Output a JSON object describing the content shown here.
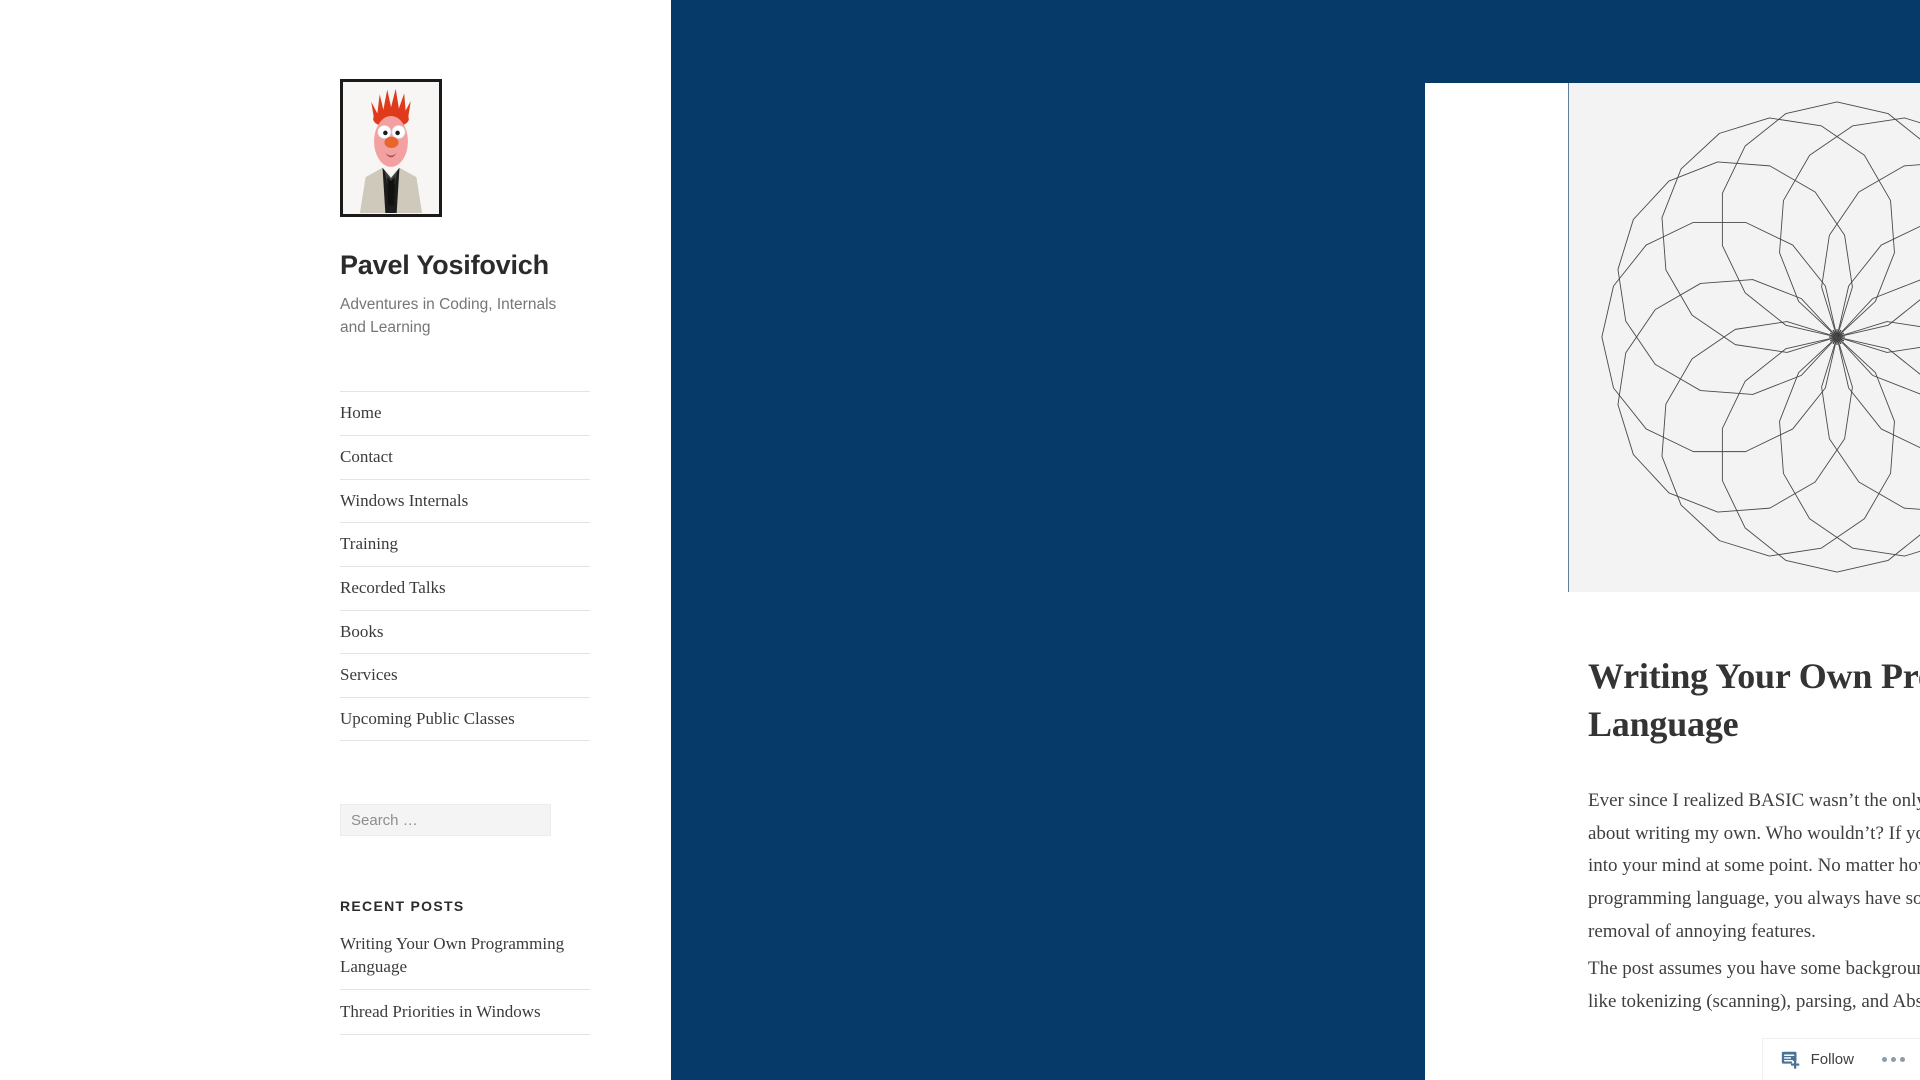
{
  "site": {
    "title": "Pavel Yosifovich",
    "description": "Adventures in Coding, Internals and Learning",
    "avatar_alt": "beaker-muppet-avatar"
  },
  "nav": {
    "items": [
      {
        "label": "Home"
      },
      {
        "label": "Contact"
      },
      {
        "label": "Windows Internals"
      },
      {
        "label": "Training"
      },
      {
        "label": "Recorded Talks"
      },
      {
        "label": "Books"
      },
      {
        "label": "Services"
      },
      {
        "label": "Upcoming Public Classes"
      }
    ]
  },
  "search": {
    "placeholder": "Search …",
    "value": ""
  },
  "recent_posts": {
    "heading": "Recent Posts",
    "items": [
      {
        "title": "Writing Your Own Programming Language"
      },
      {
        "title": "Thread Priorities in Windows"
      }
    ]
  },
  "post": {
    "featured_image_alt": "spirograph-rose-pattern",
    "title": "Writing Your Own Programming Language",
    "paragraphs": [
      "Ever since I realized BASIC wasn’t the only living programming language, I thought about writing my own. Who wouldn’t? If you’re a developer, surely this idea popped into your mind at some point. No matter how much you love a particular programming language, you always have some ideas for improvement or even removal of annoying features.",
      "The post assumes you have some background in compilers, and understand concepts like tokenizing (scanning), parsing, and Abstract Syntax Trees (ASTs)"
    ]
  },
  "follow_bar": {
    "label": "Follow",
    "icon": "subscribe-add-icon",
    "more_icon": "ellipsis-icon"
  },
  "colors": {
    "backdrop_blue": "#063a68",
    "text_dark": "#343434",
    "muted_text": "#767676",
    "rule": "#e4e4e4",
    "figure_bg": "#f3f3f3",
    "figure_border": "#5f7f9b"
  }
}
